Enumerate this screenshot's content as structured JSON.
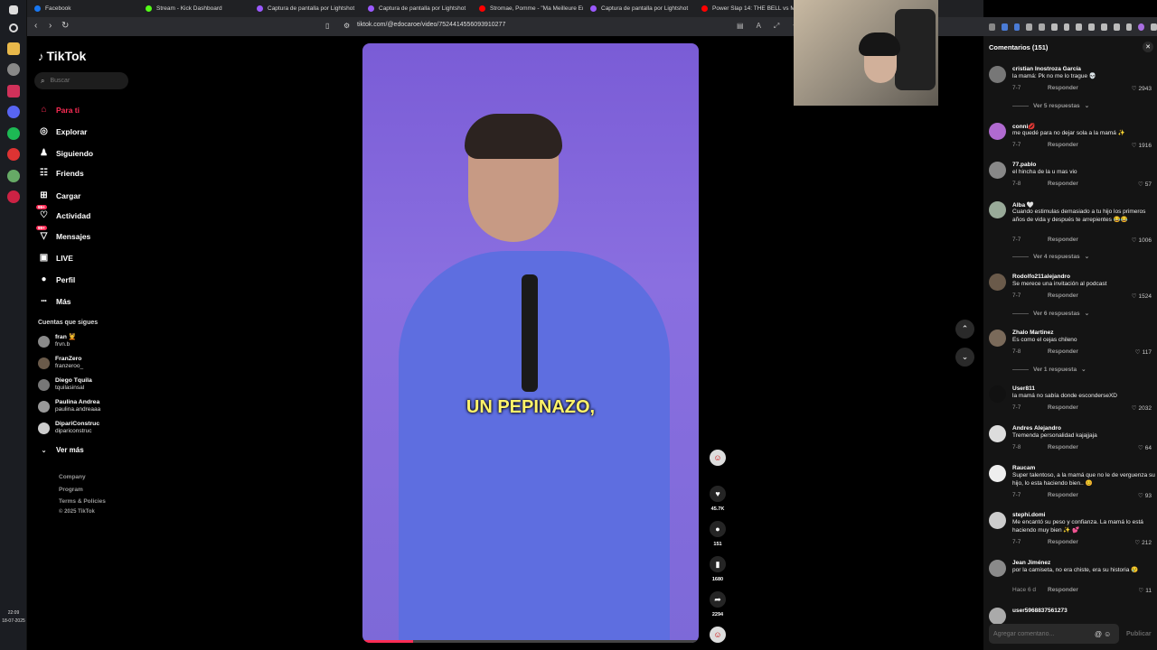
{
  "browser": {
    "tabs": [
      {
        "label": "Facebook",
        "color": "#1877f2"
      },
      {
        "label": "Stream - Kick Dashboard",
        "color": "#53fc18"
      },
      {
        "label": "Captura de pantalla por Lightshot",
        "color": "#9b59ff"
      },
      {
        "label": "Captura de pantalla por Lightshot",
        "color": "#9b59ff"
      },
      {
        "label": "Stromae, Pomme - \"Ma Meilleure En",
        "color": "#ff0000"
      },
      {
        "label": "Captura de pantalla por Lightshot",
        "color": "#9b59ff"
      },
      {
        "label": "Power Slap 14: THE BELL vs MENA",
        "color": "#ff0000"
      }
    ],
    "url": "tiktok.com/@edocaroe/video/7524414556093910277"
  },
  "taskbar": {
    "time": "22:09",
    "date": "18-07-2025"
  },
  "sidebar": {
    "logo": "TikTok",
    "search_placeholder": "Buscar",
    "nav": [
      {
        "label": "Para ti",
        "icon": "home-icon",
        "active": true
      },
      {
        "label": "Explorar",
        "icon": "compass-icon"
      },
      {
        "label": "Siguiendo",
        "icon": "following-icon"
      },
      {
        "label": "Friends",
        "icon": "friends-icon"
      },
      {
        "label": "Cargar",
        "icon": "upload-icon"
      },
      {
        "label": "Actividad",
        "icon": "activity-icon",
        "badge": "99+"
      },
      {
        "label": "Mensajes",
        "icon": "messages-icon",
        "badge": "99+"
      },
      {
        "label": "LIVE",
        "icon": "live-icon"
      },
      {
        "label": "Perfil",
        "icon": "profile-icon"
      },
      {
        "label": "Más",
        "icon": "more-icon"
      }
    ],
    "following_title": "Cuentas que sigues",
    "following": [
      {
        "name": "fran 💆",
        "username": "frvn.b"
      },
      {
        "name": "FranZero",
        "username": "franzeroo_"
      },
      {
        "name": "Diego Tquila",
        "username": "tquilasinsal"
      },
      {
        "name": "Paulina Andrea",
        "username": "paulina.andreaaa"
      },
      {
        "name": "DipariConstruc",
        "username": "dipariconstruc"
      }
    ],
    "see_more": "Ver más",
    "footer": [
      "Company",
      "Program",
      "Terms & Policies",
      "© 2025 TikTok"
    ]
  },
  "video": {
    "caption": "UN PEPINAZO,",
    "progress": 0.15,
    "actions": [
      {
        "name": "like",
        "count": "45.7K"
      },
      {
        "name": "comment",
        "count": "151"
      },
      {
        "name": "save",
        "count": "1680"
      },
      {
        "name": "share",
        "count": "2294"
      }
    ]
  },
  "comments_panel": {
    "title": "Comentarios (151)",
    "input_placeholder": "Agregar comentario...",
    "post_label": "Publicar",
    "reply_label": "Responder",
    "comments": [
      {
        "user": "cristian Inostroza García",
        "text": "la mamá: Pk no me lo trague 💀",
        "date": "7-7",
        "likes": "2943",
        "more": "Ver 5 respuestas"
      },
      {
        "user": "conni💋",
        "text": "me quedé para no dejar sola a la mamá ✨",
        "date": "7-7",
        "likes": "1916"
      },
      {
        "user": "77.pablo",
        "text": "el hincha de la u mas vio",
        "date": "7-8",
        "likes": "57"
      },
      {
        "user": "Alba 🤍",
        "text": "Cuando estimulas demasiado a tu hijo los primeros años de vida y después te arrepientes 😂😂",
        "date": "7-7",
        "likes": "1006",
        "more": "Ver 4 respuestas"
      },
      {
        "user": "Rodolfo211alejandro",
        "text": "Se merece una invitación al podcast",
        "date": "7-7",
        "likes": "1524",
        "more": "Ver 6 respuestas"
      },
      {
        "user": "Zhalo Martinez",
        "text": "Es como el cejas chileno",
        "date": "7-8",
        "likes": "117",
        "more": "Ver 1 respuesta"
      },
      {
        "user": "User811",
        "text": "la mamá no sabía donde esconderseXD",
        "date": "7-7",
        "likes": "2032"
      },
      {
        "user": "Andres Alejandro",
        "text": "Tremenda personalidad kajajjaja",
        "date": "7-8",
        "likes": "64"
      },
      {
        "user": "Raucam",
        "text": "Super talentoso, a la mamá que no le de verguenza su hijo, lo esta haciendo bien.. 😊",
        "date": "7-7",
        "likes": "93"
      },
      {
        "user": "stephi.domi",
        "text": "Me encantó su peso y confianza. La mamá lo está haciendo muy bien ✨ 💕",
        "date": "7-7",
        "likes": "212"
      },
      {
        "user": "Jean Jiménez",
        "text": "por la camiseta, no era chiste, era su historia 😢",
        "date": "Hace 6 d",
        "likes": "11"
      },
      {
        "user": "user5968837561273",
        "text": "",
        "date": "",
        "likes": ""
      }
    ]
  }
}
